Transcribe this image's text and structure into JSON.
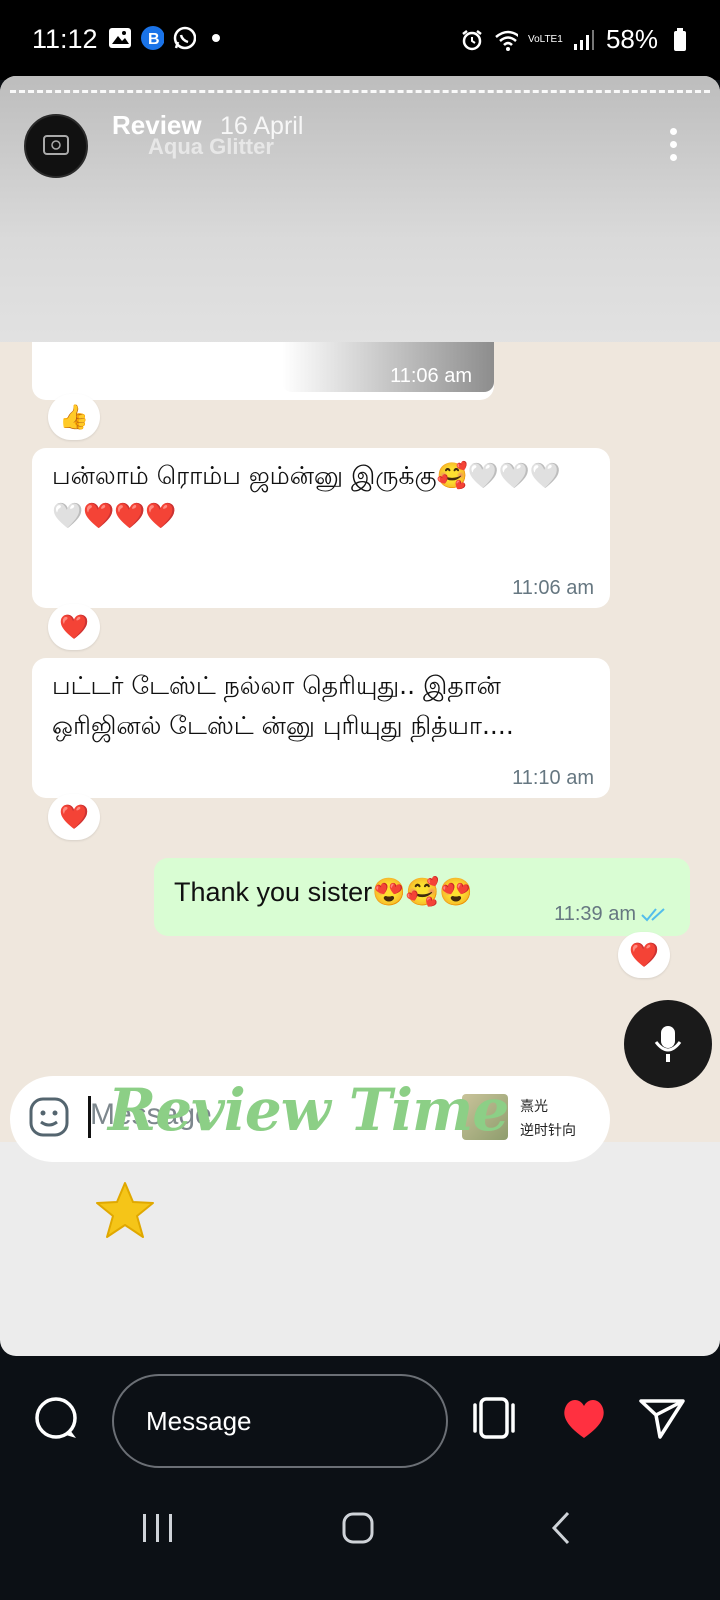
{
  "status_bar": {
    "time": "11:12",
    "battery": "58%",
    "network_label": "VoLTE1"
  },
  "story": {
    "account_name": "Review",
    "date": "16 April",
    "overlay_text": "Aqua Glitter",
    "sticker_text": "Review Time"
  },
  "chat": {
    "messages": [
      {
        "direction": "in",
        "text": "",
        "time": "11:06 am",
        "reaction": "👍"
      },
      {
        "direction": "in",
        "text": "பன்லாம் ரொம்ப ஜம்ன்னு இருக்கு🥰🤍🤍🤍🤍❤️❤️❤️",
        "time": "11:06 am",
        "reaction": "❤️"
      },
      {
        "direction": "in",
        "text": "பட்டர் டேஸ்ட் நல்லா  தெரியுது.. இதான் ஒரிஜினல் டேஸ்ட் ன்னு புரியுது நித்யா....",
        "time": "11:10 am",
        "reaction": "❤️"
      },
      {
        "direction": "out",
        "text": "Thank you sister😍🥰😍",
        "time": "11:39 am",
        "reaction": "❤️"
      }
    ],
    "composer_placeholder": "Message",
    "music": {
      "title": "熹光",
      "subtitle": "逆时针向"
    }
  },
  "reply": {
    "placeholder": "Message"
  },
  "colors": {
    "outgoing_bubble": "#d9fdd3",
    "like_red": "#ff3040",
    "read_ticks": "#53bdeb"
  }
}
